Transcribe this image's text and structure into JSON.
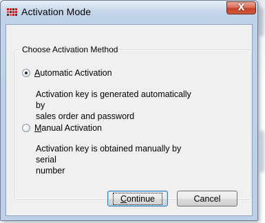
{
  "window": {
    "title": "Activation Mode",
    "close_glyph": "X",
    "icon": "app-grid-icon"
  },
  "group": {
    "title": "Choose Activation Method"
  },
  "options": [
    {
      "label_accel": "A",
      "label_rest": "utomatic Activation",
      "description_line1": "Activation key is generated automatically by",
      "description_line2": "sales order and password",
      "checked": true
    },
    {
      "label_accel": "M",
      "label_rest": "anual Activation",
      "description_line1": "Activation key is obtained manually by serial",
      "description_line2": "number",
      "checked": false
    }
  ],
  "buttons": {
    "continue_accel": "C",
    "continue_rest": "ontinue",
    "cancel_label": "Cancel"
  }
}
